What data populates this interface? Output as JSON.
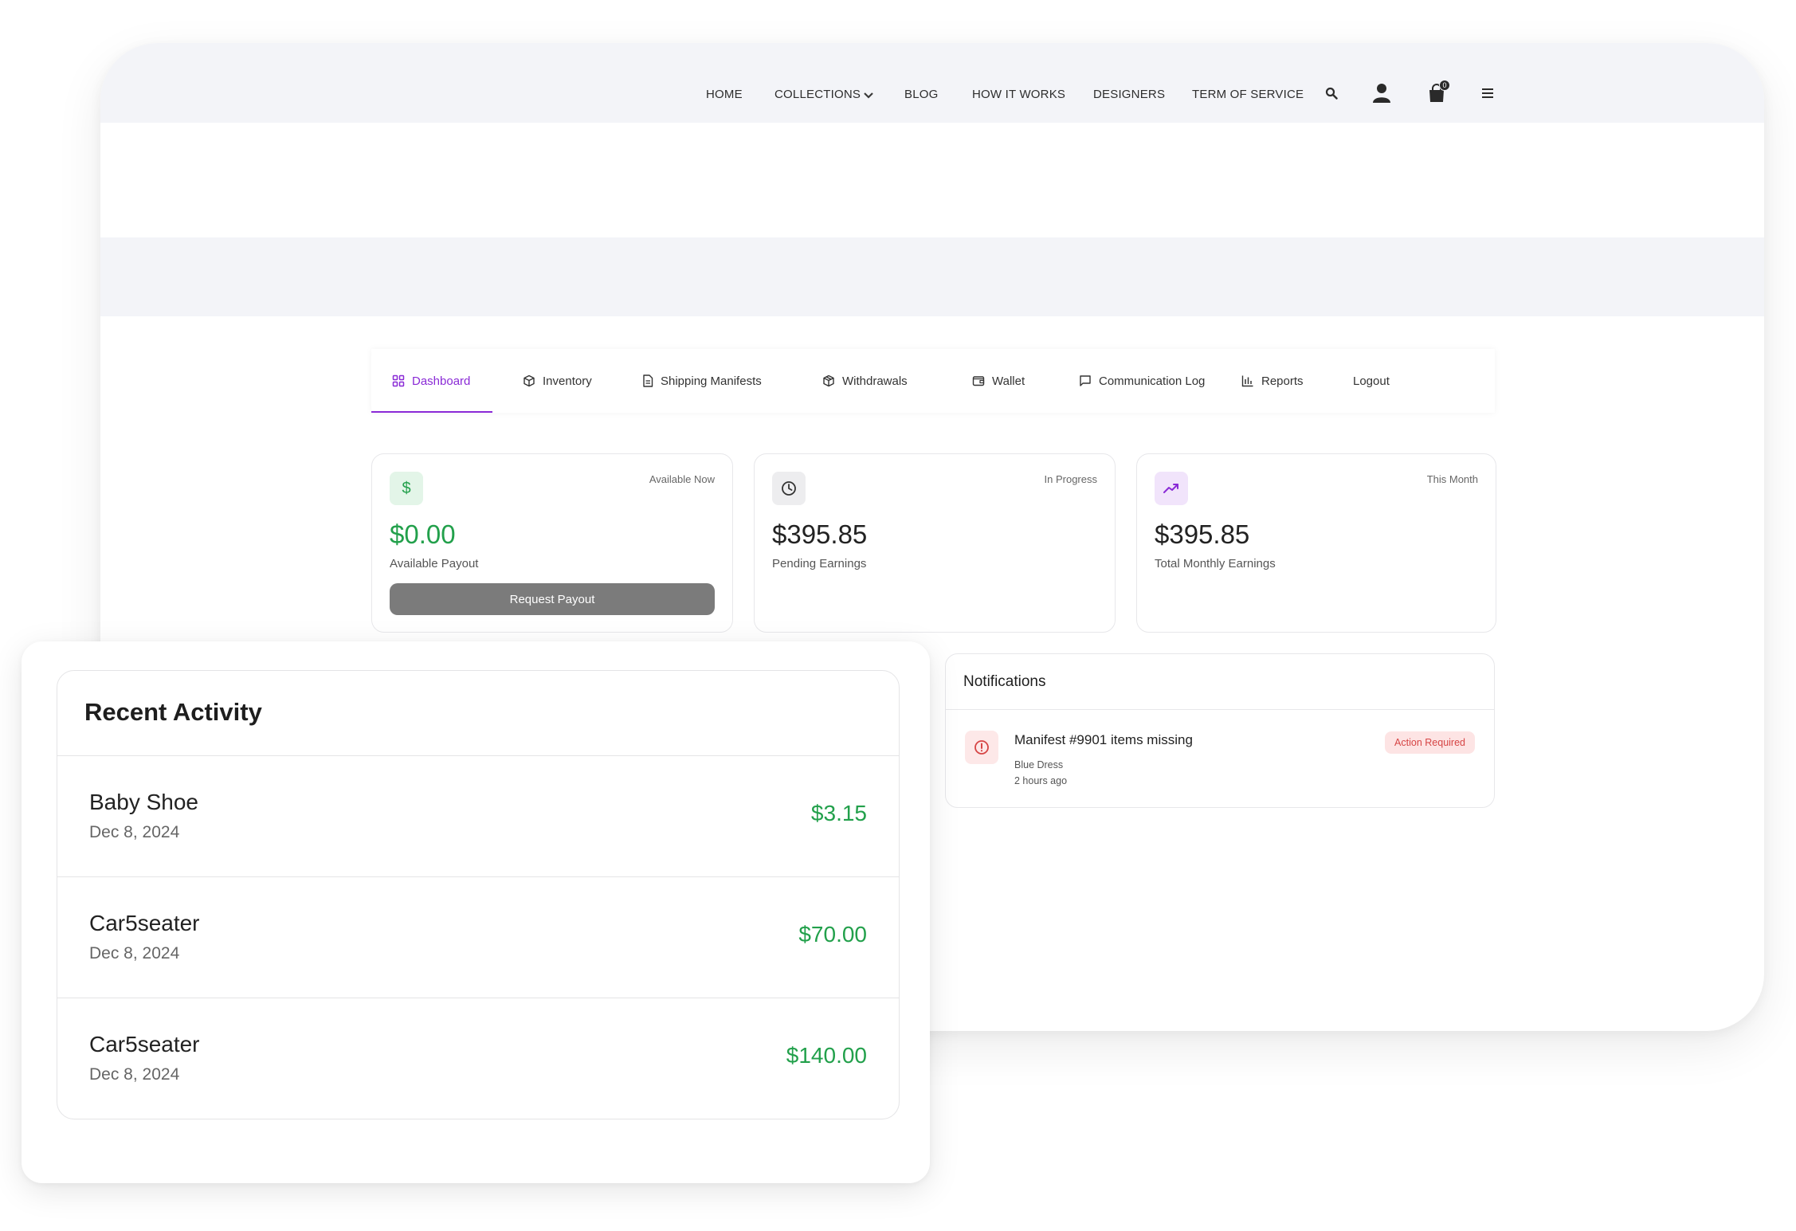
{
  "nav": {
    "home": "HOME",
    "collections": "COLLECTIONS",
    "blog": "BLOG",
    "how_it_works": "HOW IT WORKS",
    "designers": "DESIGNERS",
    "terms": "TERM OF SERVICE",
    "cart_count": "0"
  },
  "tabs": [
    {
      "label": "Dashboard",
      "active": true
    },
    {
      "label": "Inventory"
    },
    {
      "label": "Shipping Manifests"
    },
    {
      "label": "Withdrawals"
    },
    {
      "label": "Wallet"
    },
    {
      "label": "Communication Log"
    },
    {
      "label": "Reports"
    },
    {
      "label": "Logout"
    }
  ],
  "stats": {
    "available": {
      "tag": "Available Now",
      "amount": "$0.00",
      "label": "Available Payout",
      "button": "Request Payout"
    },
    "pending": {
      "tag": "In Progress",
      "amount": "$395.85",
      "label": "Pending Earnings"
    },
    "monthly": {
      "tag": "This Month",
      "amount": "$395.85",
      "label": "Total Monthly Earnings"
    }
  },
  "notifications": {
    "title": "Notifications",
    "items": [
      {
        "title": "Manifest #9901 items missing",
        "subtitle": "Blue Dress",
        "time": "2 hours ago",
        "badge": "Action Required"
      }
    ]
  },
  "recent_activity": {
    "title": "Recent Activity",
    "items": [
      {
        "name": "Baby Shoe",
        "date": "Dec 8, 2024",
        "amount": "$3.15"
      },
      {
        "name": "Car5seater",
        "date": "Dec 8, 2024",
        "amount": "$70.00"
      },
      {
        "name": "Car5seater",
        "date": "Dec 8, 2024",
        "amount": "$140.00"
      }
    ]
  },
  "colors": {
    "accent": "#8a2ad6",
    "positive": "#22a04b",
    "alert": "#d64545",
    "nav_bg": "#f3f4f8"
  }
}
